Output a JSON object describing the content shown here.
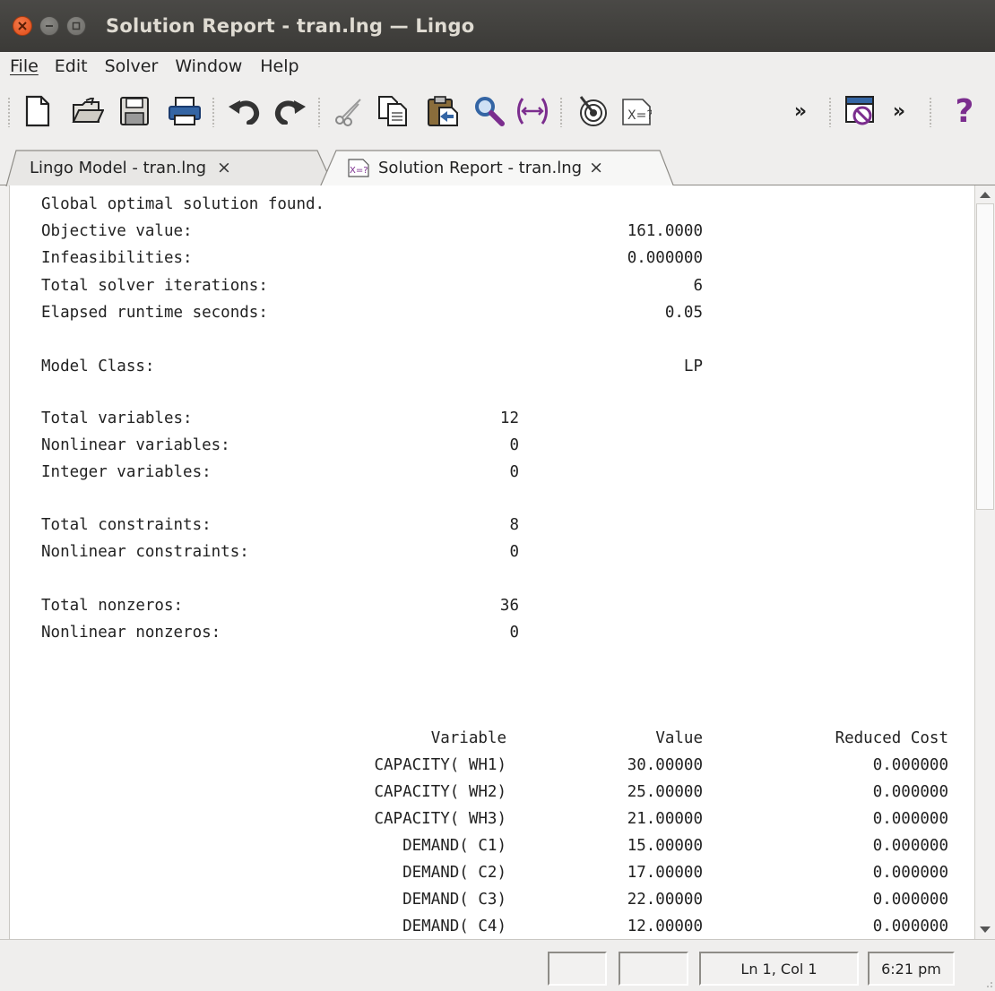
{
  "window": {
    "title": "Solution Report - tran.lng — Lingo"
  },
  "menu": [
    "File",
    "Edit",
    "Solver",
    "Window",
    "Help"
  ],
  "toolbar": {
    "icons": [
      "new-file-icon",
      "open-folder-icon",
      "save-icon",
      "print-icon",
      "undo-icon",
      "redo-icon",
      "cut-icon",
      "copy-icon",
      "paste-icon",
      "find-icon",
      "match-parenthesis-icon",
      "solve-target-icon",
      "solution-report-icon",
      "more-chevron-icon",
      "close-all-icon",
      "more-chevron-icon",
      "help-icon"
    ],
    "overflow_label": "»",
    "help_label": "?"
  },
  "tabs": [
    {
      "label": "Lingo Model - tran.lng",
      "close": "×",
      "active": false
    },
    {
      "label": "Solution Report - tran.lng",
      "close": "×",
      "active": true
    }
  ],
  "report": {
    "status": "Global optimal solution found.",
    "summary": [
      {
        "label": "Objective value:",
        "value": "161.0000"
      },
      {
        "label": "Infeasibilities:",
        "value": "0.000000"
      },
      {
        "label": "Total solver iterations:",
        "value": "6"
      },
      {
        "label": "Elapsed runtime seconds:",
        "value": "0.05"
      }
    ],
    "model_class": {
      "label": "Model Class:",
      "value": "LP"
    },
    "counts": [
      {
        "label": "Total variables:",
        "value": "12"
      },
      {
        "label": "Nonlinear variables:",
        "value": "0"
      },
      {
        "label": "Integer variables:",
        "value": "0"
      },
      {
        "label": "Total constraints:",
        "value": "8"
      },
      {
        "label": "Nonlinear constraints:",
        "value": "0"
      },
      {
        "label": "Total nonzeros:",
        "value": "36"
      },
      {
        "label": "Nonlinear nonzeros:",
        "value": "0"
      }
    ],
    "table": {
      "headers": [
        "Variable",
        "Value",
        "Reduced Cost"
      ],
      "rows": [
        [
          "CAPACITY( WH1)",
          "30.00000",
          "0.000000"
        ],
        [
          "CAPACITY( WH2)",
          "25.00000",
          "0.000000"
        ],
        [
          "CAPACITY( WH3)",
          "21.00000",
          "0.000000"
        ],
        [
          "DEMAND( C1)",
          "15.00000",
          "0.000000"
        ],
        [
          "DEMAND( C2)",
          "17.00000",
          "0.000000"
        ],
        [
          "DEMAND( C3)",
          "22.00000",
          "0.000000"
        ],
        [
          "DEMAND( C4)",
          "12.00000",
          "0.000000"
        ]
      ]
    }
  },
  "status": {
    "position": "Ln 1, Col 1",
    "time": "6:21 pm"
  },
  "colors": {
    "titlebar": "#3c3b37",
    "close_button": "#e95420",
    "background": "#f2f1f0"
  }
}
